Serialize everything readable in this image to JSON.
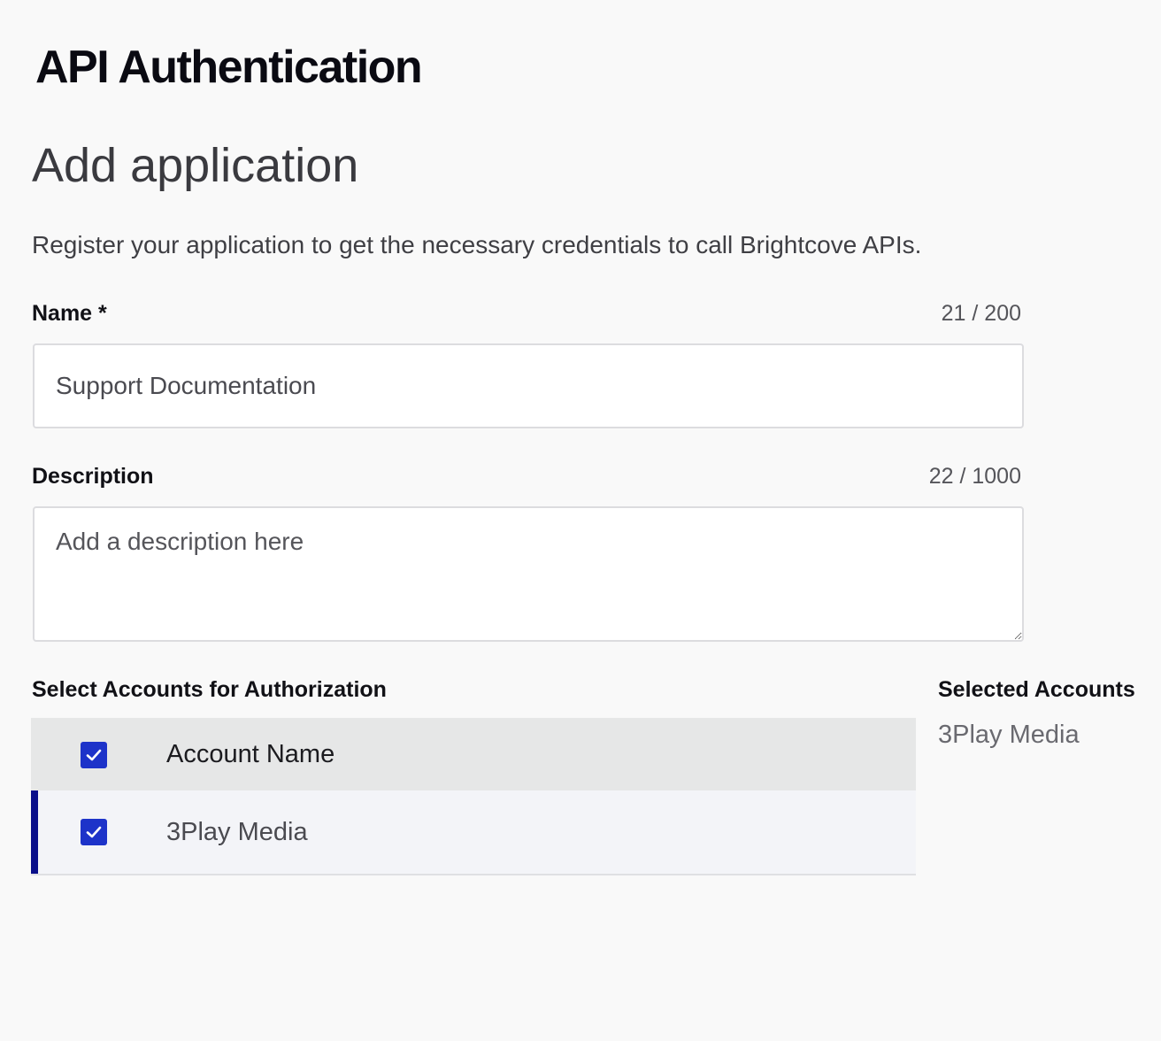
{
  "header": {
    "app_title": "API Authentication"
  },
  "page": {
    "title": "Add application",
    "intro": "Register your application to get the necessary credentials to call Brightcove APIs."
  },
  "form": {
    "name": {
      "label": "Name *",
      "counter": "21 / 200",
      "value": "Support Documentation"
    },
    "description": {
      "label": "Description",
      "counter": "22 / 1000",
      "placeholder": "Add a description here"
    }
  },
  "accounts": {
    "section_label": "Select Accounts for Authorization",
    "table": {
      "header": {
        "label": "Account Name",
        "checked": true
      },
      "rows": [
        {
          "name": "3Play Media",
          "checked": true
        }
      ]
    },
    "selected": {
      "label": "Selected Accounts",
      "items": [
        "3Play Media"
      ]
    }
  },
  "icons": {
    "checkbox_check": "check-icon"
  },
  "colors": {
    "checkbox": "#1d33c9",
    "row_accent": "#0a0f8a",
    "header_bg": "#e6e7e7",
    "row_bg": "#f3f4f8",
    "page_bg": "#f9f9f9"
  }
}
